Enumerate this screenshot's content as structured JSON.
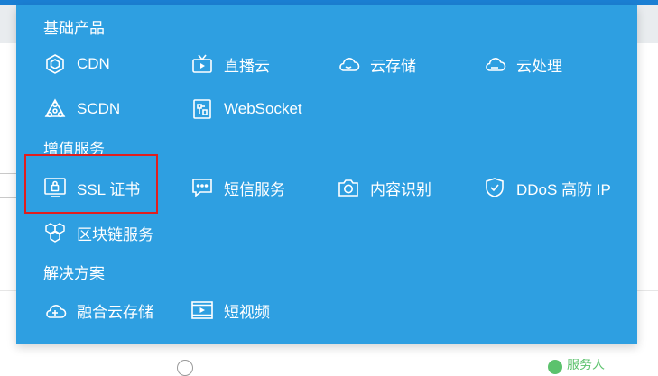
{
  "background": {
    "fragments": [
      "​​​",
      "​​​​"
    ],
    "link_right": "服务人"
  },
  "menu": {
    "sections": [
      {
        "title": "基础产品",
        "items": [
          {
            "label": "CDN",
            "icon": "cdn-icon"
          },
          {
            "label": "直播云",
            "icon": "live-stream-icon"
          },
          {
            "label": "云存储",
            "icon": "cloud-storage-icon"
          },
          {
            "label": "云处理",
            "icon": "cloud-processing-icon"
          },
          {
            "label": "SCDN",
            "icon": "scdn-icon"
          },
          {
            "label": "WebSocket",
            "icon": "websocket-icon"
          }
        ]
      },
      {
        "title": "增值服务",
        "items": [
          {
            "label": "SSL 证书",
            "icon": "ssl-certificate-icon"
          },
          {
            "label": "短信服务",
            "icon": "sms-icon"
          },
          {
            "label": "内容识别",
            "icon": "camera-icon"
          },
          {
            "label": "DDoS 高防 IP",
            "icon": "shield-icon"
          },
          {
            "label": "区块链服务",
            "icon": "blockchain-icon"
          }
        ]
      },
      {
        "title": "解决方案",
        "items": [
          {
            "label": "融合云存储",
            "icon": "cloud-plus-icon"
          },
          {
            "label": "短视频",
            "icon": "video-play-icon"
          }
        ]
      }
    ]
  },
  "colors": {
    "panel_bg": "#2e9fe1",
    "topbar": "#1b7fd3",
    "highlight_border": "#e01e1e"
  }
}
